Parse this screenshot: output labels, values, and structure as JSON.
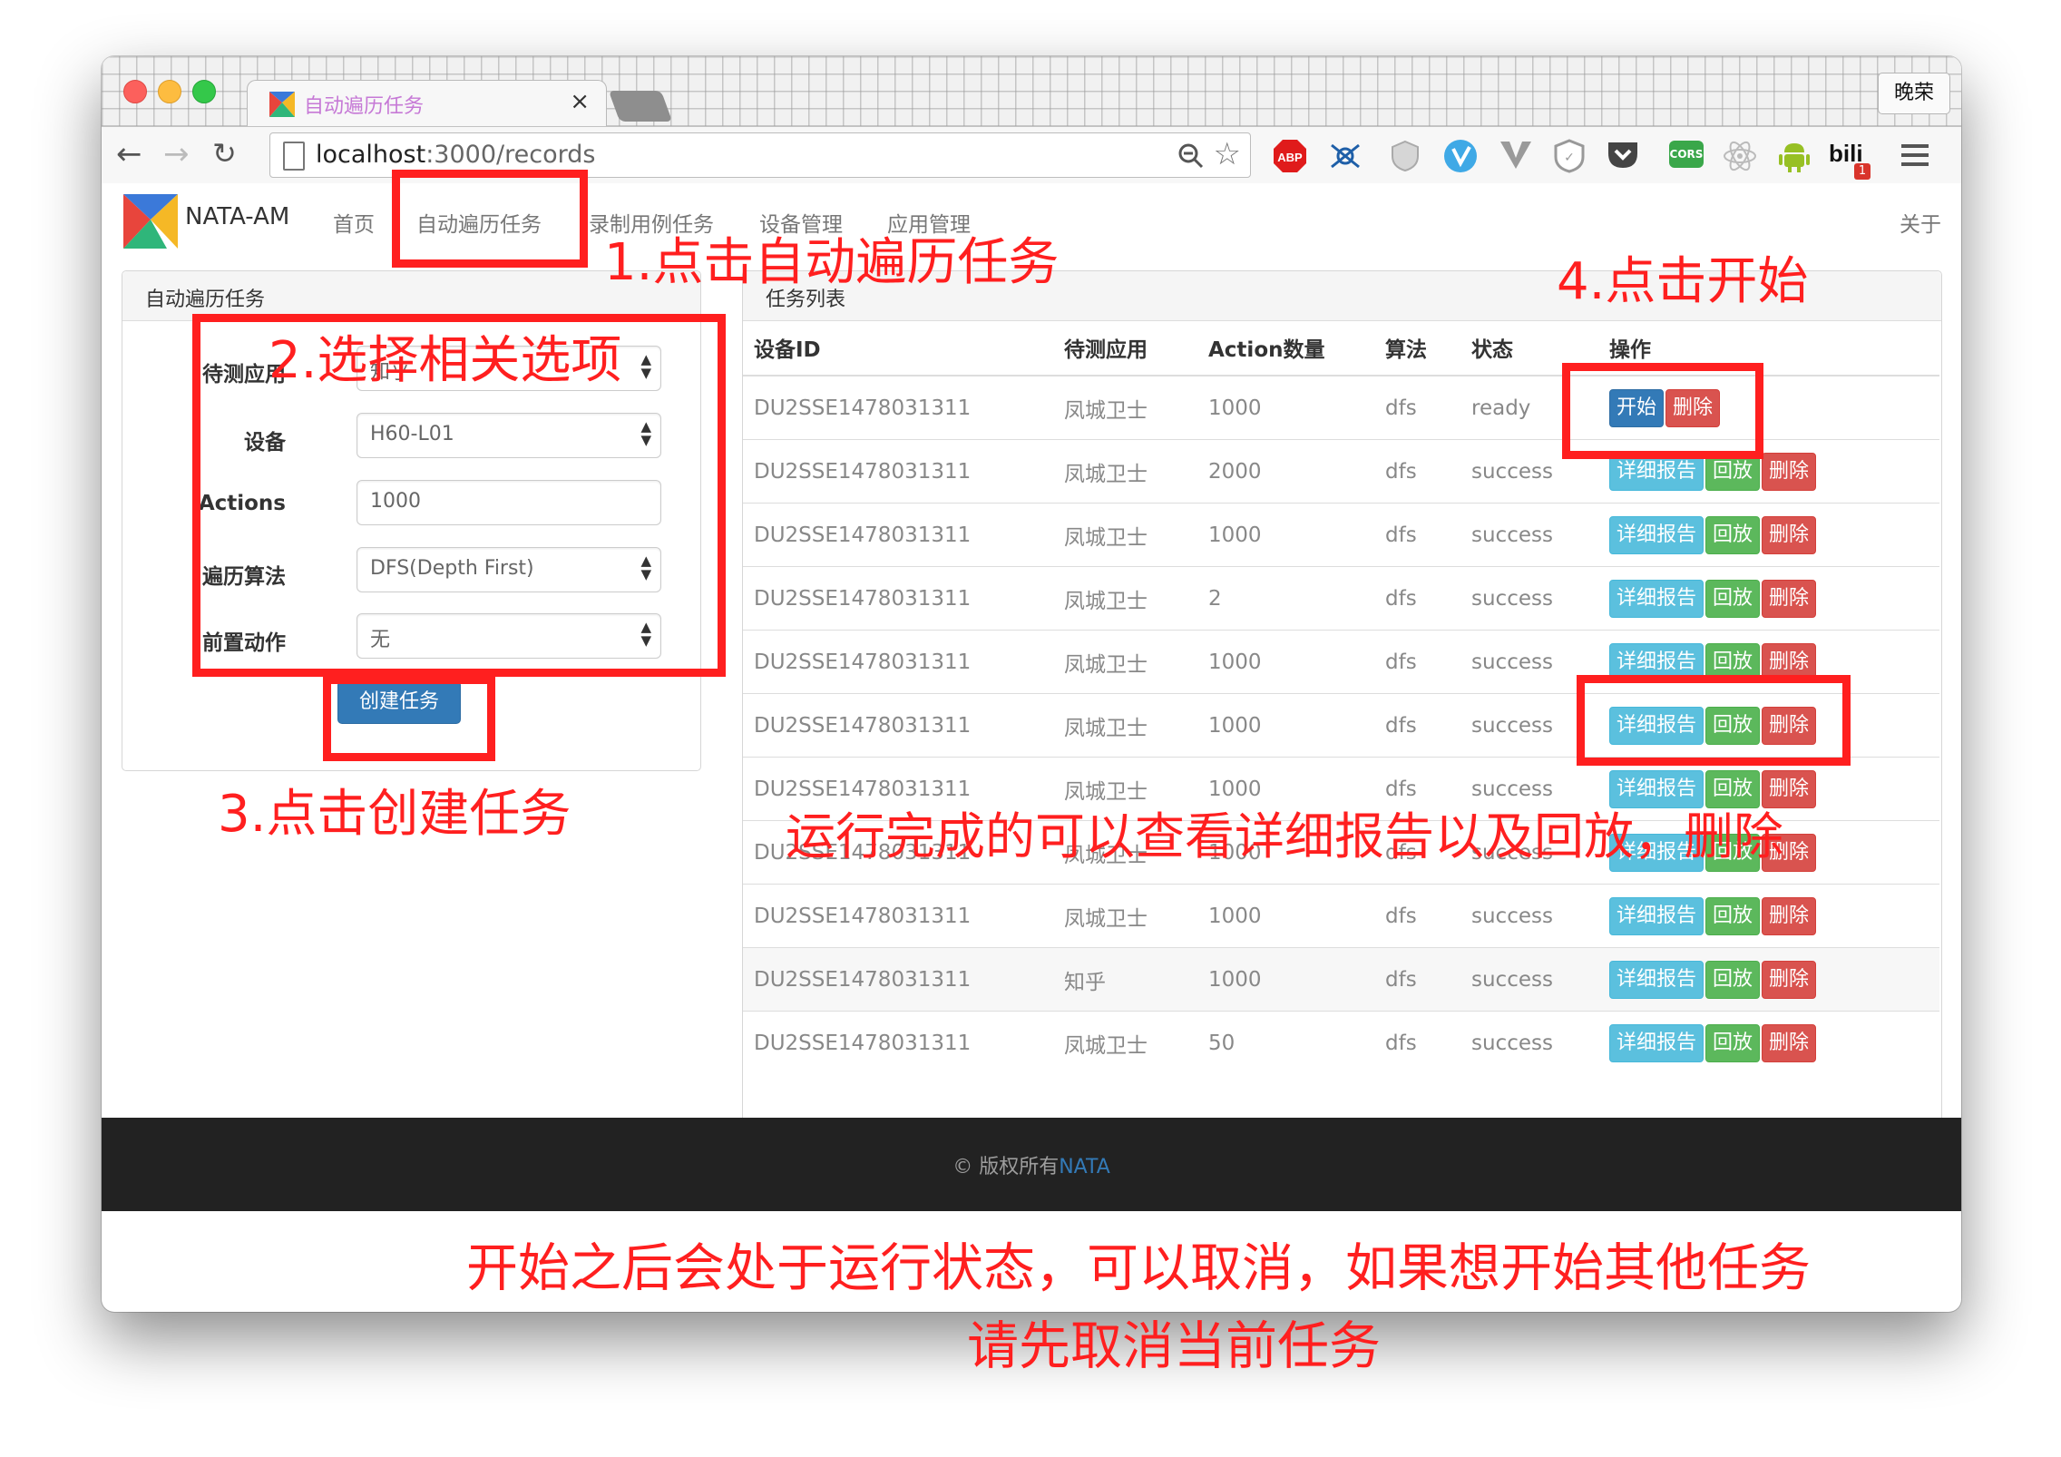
{
  "browser": {
    "tab_title": "自动遍历任务",
    "tab_close": "×",
    "profile_name": "晚荣",
    "url_host": "localhost",
    "url_path": ":3000/records",
    "extensions": {
      "abp": "ABP",
      "cors": "CORS",
      "bili": "bili",
      "bili_badge": "1"
    }
  },
  "navbar": {
    "brand": "NATA-AM",
    "items": [
      "首页",
      "自动遍历任务",
      "录制用例任务",
      "设备管理",
      "应用管理"
    ],
    "right_item": "关于"
  },
  "create_panel": {
    "title": "自动遍历任务",
    "fields": [
      {
        "label": "待测应用",
        "value": "知乎"
      },
      {
        "label": "设备",
        "value": "H60-L01"
      },
      {
        "label": "Actions",
        "value": "1000"
      },
      {
        "label": "遍历算法",
        "value": "DFS(Depth First)"
      },
      {
        "label": "前置动作",
        "value": "无"
      }
    ],
    "submit_label": "创建任务"
  },
  "task_panel": {
    "title": "任务列表",
    "columns": [
      "设备ID",
      "待测应用",
      "Action数量",
      "算法",
      "状态",
      "操作"
    ],
    "rows": [
      {
        "device": "DU2SSE1478031311",
        "app": "凤城卫士",
        "actions": "1000",
        "algo": "dfs",
        "status": "ready"
      },
      {
        "device": "DU2SSE1478031311",
        "app": "凤城卫士",
        "actions": "2000",
        "algo": "dfs",
        "status": "success"
      },
      {
        "device": "DU2SSE1478031311",
        "app": "凤城卫士",
        "actions": "1000",
        "algo": "dfs",
        "status": "success"
      },
      {
        "device": "DU2SSE1478031311",
        "app": "凤城卫士",
        "actions": "2",
        "algo": "dfs",
        "status": "success"
      },
      {
        "device": "DU2SSE1478031311",
        "app": "凤城卫士",
        "actions": "1000",
        "algo": "dfs",
        "status": "success"
      },
      {
        "device": "DU2SSE1478031311",
        "app": "凤城卫士",
        "actions": "1000",
        "algo": "dfs",
        "status": "success"
      },
      {
        "device": "DU2SSE1478031311",
        "app": "凤城卫士",
        "actions": "1000",
        "algo": "dfs",
        "status": "success"
      },
      {
        "device": "DU2SSE1478031311",
        "app": "凤城卫士",
        "actions": "1000",
        "algo": "dfs",
        "status": "success"
      },
      {
        "device": "DU2SSE1478031311",
        "app": "凤城卫士",
        "actions": "1000",
        "algo": "dfs",
        "status": "success"
      },
      {
        "device": "DU2SSE1478031311",
        "app": "知乎",
        "actions": "1000",
        "algo": "dfs",
        "status": "success"
      },
      {
        "device": "DU2SSE1478031311",
        "app": "凤城卫士",
        "actions": "50",
        "algo": "dfs",
        "status": "success"
      }
    ],
    "buttons": {
      "start": "开始",
      "delete": "删除",
      "report": "详细报告",
      "replay": "回放"
    }
  },
  "footer": {
    "copyright": "© 版权所有",
    "brand": "NATA"
  },
  "annotations": {
    "step1": "1.点击自动遍历任务",
    "step2": "2.选择相关选项",
    "step3": "3.点击创建任务",
    "step4": "4.点击开始",
    "note_finished": "运行完成的可以查看详细报告以及回放，删除",
    "note_bottom_line1": "开始之后会处于运行状态，可以取消，如果想开始其他任务",
    "note_bottom_line2": "请先取消当前任务"
  },
  "colors": {
    "annotation_red": "#ff1f1f",
    "btn_primary": "#337ab7",
    "btn_info": "#5bc0de",
    "btn_success": "#5cb85c",
    "btn_danger": "#d9534f",
    "footer_bg": "#222222"
  }
}
